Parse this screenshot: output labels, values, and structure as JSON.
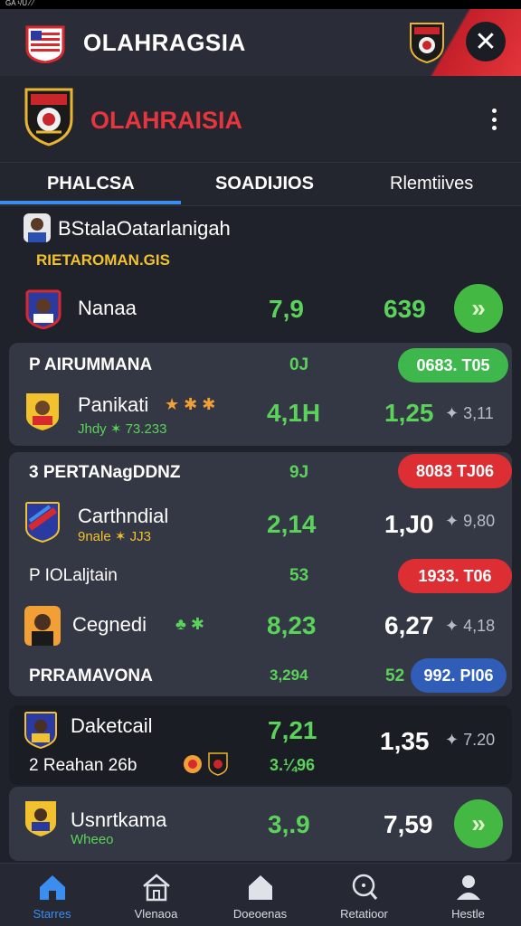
{
  "status": {
    "text": "GA ¹/U ⁄ ⁄"
  },
  "topbar": {
    "title": "OLAHRAGSIA"
  },
  "header": {
    "title": "OLAHRAISIA"
  },
  "tabs": [
    {
      "label": "PHALCSA"
    },
    {
      "label": "SOADIJIOS"
    },
    {
      "label": "Rlemtiives"
    }
  ],
  "featured": {
    "heading": "BStalaOatarlanigah",
    "subheading": "RIETAROMAN.GIS",
    "player": {
      "name": "Nanaa",
      "value1": "7,9",
      "value2": "639"
    }
  },
  "cards": [
    {
      "title": "P  AIRUMMANA",
      "title_value": "0J",
      "pill": "0683. T05",
      "player": {
        "name": "Panikati",
        "icons": "★ ✱ ✱",
        "subtitle": "Jhdy ✶ 73.233",
        "value1": "4,1H",
        "value2": "1,25",
        "extra": "✦ 3,11"
      }
    },
    {
      "title": "3  PERTANagDDNZ",
      "title_value": "9J",
      "pill": "8083 TJ06",
      "player": {
        "name": "Carthndial",
        "subtitle": "9nale ✶ JJ3",
        "value1": "2,14",
        "value2": "1,J0",
        "extra": "✦ 9,80"
      },
      "row2_title": "P  IOLaljtain",
      "row2_value": "53",
      "pill2": "1933. T06",
      "player2": {
        "name": "Cegnedi",
        "icons": "♣ ✱",
        "value1": "8,23",
        "value2": "6,27",
        "extra": "✦ 4,18"
      },
      "row3_title": "PRRAMAVONA",
      "row3_value1": "3,294",
      "row3_value2": "52",
      "pill3": "992. PI06"
    }
  ],
  "dark_card": {
    "name": "Daketcail",
    "value1": "7,21",
    "value2": "1,35",
    "extra": "✦ 7.20",
    "subtitle": "2  Reahan 26b",
    "subvalue": "3.¼96"
  },
  "last_card": {
    "name": "Usnrtkama",
    "subtitle": "Wheeo",
    "value1": "3,.9",
    "value2": "7,59"
  },
  "bottom_nav": [
    {
      "label": "Starres",
      "icon": "home-icon"
    },
    {
      "label": "Vlenaoa",
      "icon": "house-outline-icon"
    },
    {
      "label": "Doeoenas",
      "icon": "home-solid-icon"
    },
    {
      "label": "Retatioor",
      "icon": "search-icon"
    },
    {
      "label": "Hestle",
      "icon": "profile-icon"
    }
  ],
  "colors": {
    "accent_blue": "#3b8ef0",
    "green": "#5bd25a",
    "red": "#dd2f33",
    "header_red": "#e5363d",
    "yellow": "#f2c12e"
  }
}
